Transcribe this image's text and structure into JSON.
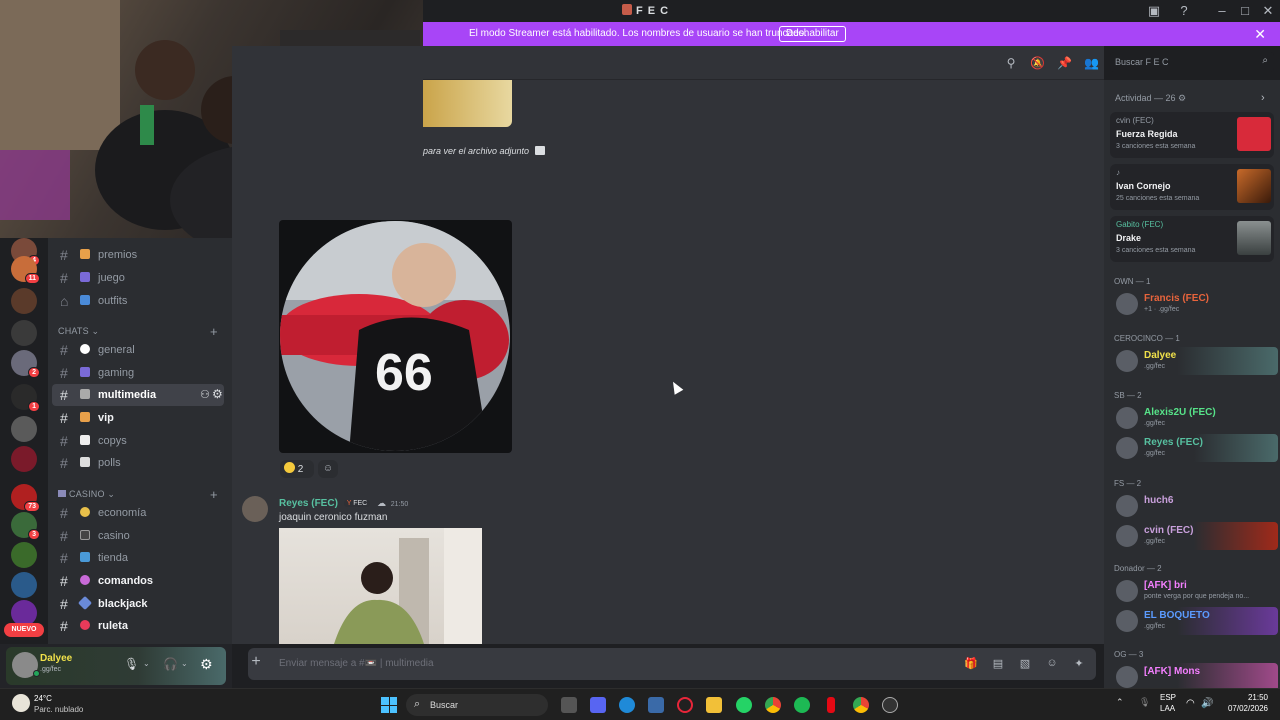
{
  "window": {
    "title": "F E C"
  },
  "banner": {
    "message": "El modo Streamer está habilitado. Los nombres de usuario se han truncado.",
    "button": "Deshabilitar"
  },
  "rail": {
    "badges": [
      "4",
      "11",
      "2",
      "1",
      "73",
      "3"
    ],
    "nuevo": "NUEVO"
  },
  "channels": {
    "top": [
      {
        "name": "premios"
      },
      {
        "name": "juego"
      },
      {
        "name": "outfits"
      }
    ],
    "cat_chats": "CHATS",
    "chats": [
      {
        "name": "general"
      },
      {
        "name": "gaming"
      },
      {
        "name": "multimedia"
      },
      {
        "name": "vip"
      },
      {
        "name": "copys"
      },
      {
        "name": "polls"
      }
    ],
    "cat_casino": "CASINO",
    "casino": [
      {
        "name": "economía"
      },
      {
        "name": "casino"
      },
      {
        "name": "tienda"
      },
      {
        "name": "comandos"
      },
      {
        "name": "blackjack"
      },
      {
        "name": "ruleta"
      }
    ]
  },
  "user": {
    "name": "Dalyee",
    "status": ".gg/fec"
  },
  "chat": {
    "attachment_note": "para ver el archivo adjunto",
    "reaction_count": "2",
    "msg2": {
      "author": "Reyes (FEC)",
      "tag": "FEC",
      "time": "21:50",
      "text": "joaquin ceronico fuzman"
    },
    "composer_placeholder": "Enviar mensaje a #📼 | multimedia"
  },
  "members": {
    "search_placeholder": "Buscar F E C",
    "activity_header": "Actividad — 26",
    "activities": [
      {
        "who": "cvin (FEC)",
        "song": "Fuerza Regida",
        "sub": "3 canciones esta semana"
      },
      {
        "who": "",
        "song": "Ivan Cornejo",
        "sub": "25 canciones esta semana"
      },
      {
        "who": "Gabito (FEC)",
        "song": "Drake",
        "sub": "3 canciones esta semana"
      }
    ],
    "groups": [
      {
        "role": "OWN — 1",
        "members": [
          {
            "name": "Francis (FEC)",
            "status": "+1 · .gg/fec",
            "color": "#e8643c"
          }
        ]
      },
      {
        "role": "CEROCINCO — 1",
        "members": [
          {
            "name": "Dalyee",
            "status": ".gg/fec",
            "color": "#f0e14a"
          }
        ]
      },
      {
        "role": "SB — 2",
        "members": [
          {
            "name": "Alexis2U (FEC)",
            "status": ".gg/fec",
            "color": "#57e389"
          },
          {
            "name": "Reyes (FEC)",
            "status": ".gg/fec",
            "color": "#57c0a0"
          }
        ]
      },
      {
        "role": "FS — 2",
        "members": [
          {
            "name": "huch6",
            "status": "",
            "color": "#c9a0dc"
          },
          {
            "name": "cvin (FEC)",
            "status": ".gg/fec",
            "color": "#c9a0dc"
          }
        ]
      },
      {
        "role": "Donador — 2",
        "members": [
          {
            "name": "[AFK] bri",
            "status": "ponte verga por que pendeja no...",
            "color": "#f47fff"
          },
          {
            "name": "EL BOQUETO",
            "status": ".gg/fec",
            "color": "#5b9bff"
          }
        ]
      },
      {
        "role": "OG — 3",
        "members": [
          {
            "name": "[AFK] Mons",
            "status": "",
            "color": "#f47fff"
          }
        ]
      }
    ]
  },
  "taskbar": {
    "weather_temp": "24°C",
    "weather_desc": "Parc. nublado",
    "search": "Buscar",
    "lang": "ESP",
    "lang2": "LAA",
    "time": "21:50",
    "date": "07/02/2026"
  }
}
